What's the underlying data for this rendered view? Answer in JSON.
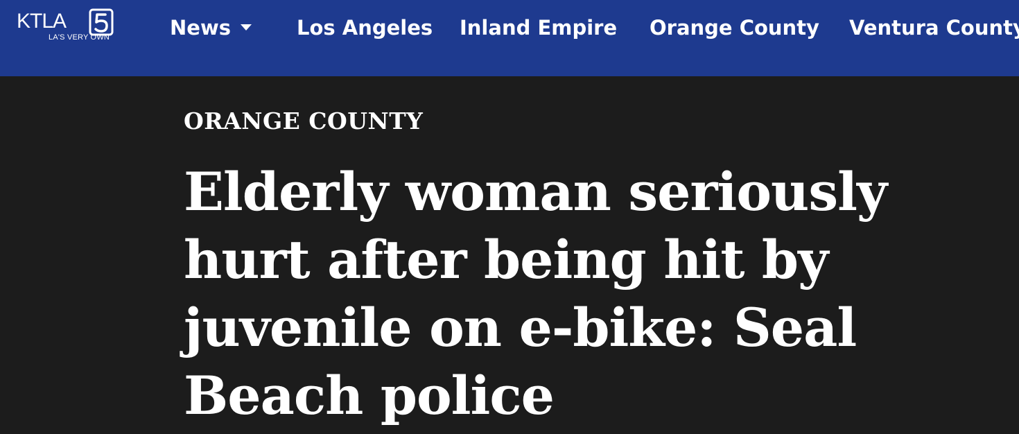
{
  "brand": {
    "logo_text": "KTLA",
    "logo_number": "5",
    "tagline": "LA'S VERY OWN",
    "nav_color": "#1e3a8f",
    "background": "#1c1c1c"
  },
  "nav": {
    "items": [
      {
        "label": "News",
        "has_dropdown": true
      },
      {
        "label": "Los Angeles"
      },
      {
        "label": "Inland Empire"
      },
      {
        "label": "Orange County"
      },
      {
        "label": "Ventura County"
      }
    ]
  },
  "article": {
    "category": "ORANGE COUNTY",
    "headline": "Elderly woman seriously hurt after being hit by juvenile on e-bike: Seal Beach police"
  }
}
